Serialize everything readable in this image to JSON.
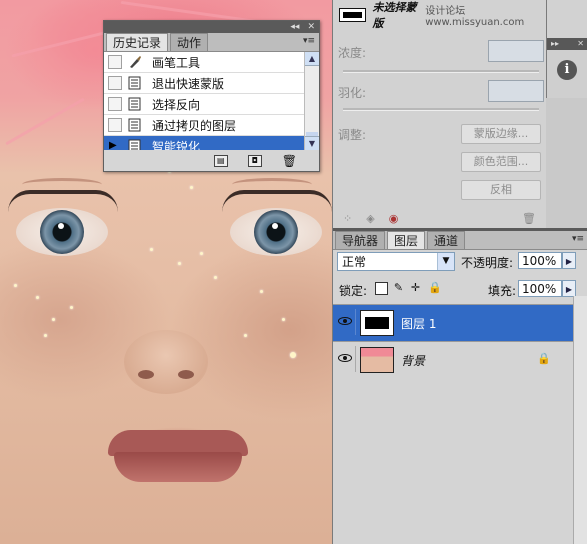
{
  "history_panel": {
    "tabs": [
      "历史记录",
      "动作"
    ],
    "items": [
      {
        "label": "画笔工具",
        "selected": false
      },
      {
        "label": "退出快速蒙版",
        "selected": false
      },
      {
        "label": "选择反向",
        "selected": false
      },
      {
        "label": "通过拷贝的图层",
        "selected": false
      },
      {
        "label": "智能锐化",
        "selected": true
      }
    ]
  },
  "mask_panel": {
    "title": "未选择蒙版",
    "watermark": "设计论坛 www.missyuan.com",
    "density_label": "浓度:",
    "feather_label": "羽化:",
    "adjust_label": "调整:",
    "buttons": [
      "蒙版边缘...",
      "颜色范围...",
      "反相"
    ]
  },
  "layers_panel": {
    "tabs": [
      "导航器",
      "图层",
      "通道"
    ],
    "active_tab": "图层",
    "blend_mode": "正常",
    "opacity_label": "不透明度:",
    "opacity_value": "100%",
    "lock_label": "锁定:",
    "fill_label": "填充:",
    "fill_value": "100%",
    "layers": [
      {
        "name": "图层 1",
        "selected": true
      },
      {
        "name": "背景",
        "selected": false
      }
    ]
  },
  "colors": {
    "selection": "#316ac5",
    "panel_bg": "#d4d4d4",
    "titlebar": "#5a5a5a"
  }
}
